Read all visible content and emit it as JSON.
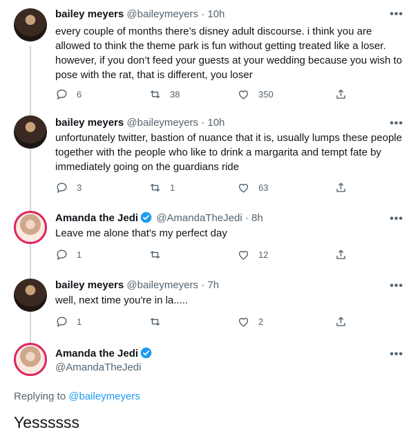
{
  "tweets": [
    {
      "name": "bailey meyers",
      "handle": "@baileymeyers",
      "time": "10h",
      "text": "every couple of months there’s disney adult discourse. i think you are allowed to think the theme park is fun without getting treated like a loser. however, if you don’t feed your guests at your wedding because you wish to pose with the rat, that is different, you loser",
      "replies": "6",
      "retweets": "38",
      "likes": "350"
    },
    {
      "name": "bailey meyers",
      "handle": "@baileymeyers",
      "time": "10h",
      "text": "unfortunately twitter, bastion of nuance that it is, usually lumps these people together with the people who like to drink a margarita and tempt fate by immediately going on the guardians ride",
      "replies": "3",
      "retweets": "1",
      "likes": "63"
    },
    {
      "name": "Amanda the Jedi",
      "handle": "@AmandaTheJedi",
      "time": "8h",
      "text": "Leave me alone that's my perfect day",
      "replies": "1",
      "retweets": "",
      "likes": "12"
    },
    {
      "name": "bailey meyers",
      "handle": "@baileymeyers",
      "time": "7h",
      "text": "well, next time you're in la.....",
      "replies": "1",
      "retweets": "",
      "likes": "2"
    }
  ],
  "main": {
    "name": "Amanda the Jedi",
    "handle": "@AmandaTheJedi",
    "replying_prefix": "Replying to",
    "replying_handle": "@baileymeyers",
    "text": "Yessssss"
  },
  "more_glyph": "•••",
  "separator": "·",
  "colors": {
    "accent": "#1d9bf0",
    "muted": "#536471",
    "line": "#cfd9de"
  }
}
